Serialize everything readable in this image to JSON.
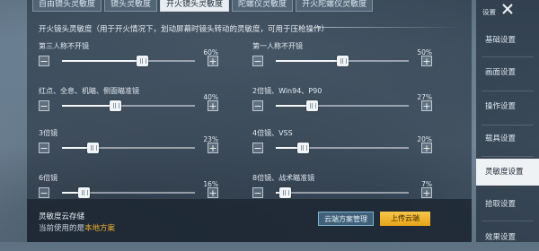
{
  "top_tabs": [
    {
      "label": "自由镜头灵敏度",
      "active": false
    },
    {
      "label": "镜头灵敏度",
      "active": false
    },
    {
      "label": "开火镜头灵敏度",
      "active": true
    },
    {
      "label": "陀螺仪灵敏度",
      "active": false
    },
    {
      "label": "开火陀螺仪灵敏度",
      "active": false
    }
  ],
  "section": {
    "title": "开火镜头灵敏度（用于开火情况下，划动屏幕时镜头转动的灵敏度，可用于压枪操作）"
  },
  "sliders": [
    {
      "label": "第三人称不开镜",
      "value": 60,
      "display": "60%",
      "min_icon": "minus-icon",
      "max_icon": "plus-icon"
    },
    {
      "label": "第一人称不开镜",
      "value": 50,
      "display": "50%",
      "min_icon": "minus-icon",
      "max_icon": "plus-icon"
    },
    {
      "label": "红点、全息、机瞄、侧面瞄准镜",
      "value": 40,
      "display": "40%",
      "min_icon": "minus-icon",
      "max_icon": "plus-icon"
    },
    {
      "label": "2倍镜、Win94、P90",
      "value": 27,
      "display": "27%",
      "min_icon": "minus-icon",
      "max_icon": "plus-icon"
    },
    {
      "label": "3倍镜",
      "value": 23,
      "display": "23%",
      "min_icon": "minus-icon",
      "max_icon": "plus-icon"
    },
    {
      "label": "4倍镜、VSS",
      "value": 20,
      "display": "20%",
      "min_icon": "minus-icon",
      "max_icon": "plus-icon"
    },
    {
      "label": "6倍镜",
      "value": 16,
      "display": "16%",
      "min_icon": "minus-icon",
      "max_icon": "plus-icon"
    },
    {
      "label": "8倍镜、战术瞄准镜",
      "value": 7,
      "display": "7%",
      "min_icon": "minus-icon",
      "max_icon": "plus-icon"
    }
  ],
  "cloud": {
    "title": "灵敏度云存储",
    "current_prefix": "当前使用的是",
    "current_plan": "本地方案",
    "manage_button": "云端方案管理",
    "upload_button": "上传云端"
  },
  "sidebar": {
    "header": "设置",
    "close_icon": "close-icon",
    "items": [
      {
        "label": "基础设置",
        "active": false
      },
      {
        "label": "画面设置",
        "active": false
      },
      {
        "label": "操作设置",
        "active": false
      },
      {
        "label": "载具设置",
        "active": false
      },
      {
        "label": "灵敏度设置",
        "active": true
      },
      {
        "label": "拾取设置",
        "active": false
      },
      {
        "label": "效果设置",
        "active": false
      }
    ]
  },
  "colors": {
    "accent_gold": "#f0b030",
    "upload_button": "#e6a518",
    "active_tab_bg": "#e9eef2",
    "manage_button_border": "#7fb2d2"
  }
}
